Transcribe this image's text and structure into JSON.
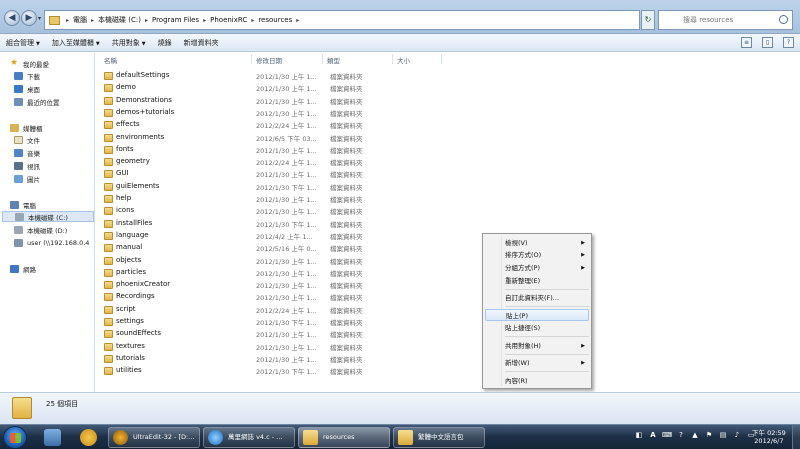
{
  "address": {
    "crumbs": [
      "電腦",
      "本機磁碟 (C:)",
      "Program Files",
      "PhoenixRC",
      "resources"
    ],
    "search_placeholder": "搜尋 resources"
  },
  "toolbar": {
    "organize": "組合管理",
    "include_library": "加入至媒體櫃",
    "share": "共用對象",
    "burn": "燒錄",
    "new_folder": "新增資料夾"
  },
  "nav": {
    "favorites": "我的最愛",
    "downloads": "下載",
    "desktop": "桌面",
    "recent": "最近的位置",
    "libraries": "媒體櫃",
    "documents": "文件",
    "music": "音樂",
    "videos": "視訊",
    "pictures": "圖片",
    "computer": "電腦",
    "drive_c": "本機磁碟 (C:)",
    "drive_d": "本機磁碟 (D:)",
    "network_drive": "user (\\\\192.168.0.4",
    "network": "網路"
  },
  "columns": {
    "name": "名稱",
    "date": "修改日期",
    "type": "類型",
    "size": "大小"
  },
  "files": [
    {
      "name": "defaultSettings",
      "date": "2012/1/30 上午 1...",
      "type": "檔案資料夾"
    },
    {
      "name": "demo",
      "date": "2012/1/30 上午 1...",
      "type": "檔案資料夾"
    },
    {
      "name": "Demonstrations",
      "date": "2012/1/30 上午 1...",
      "type": "檔案資料夾"
    },
    {
      "name": "demos+tutorials",
      "date": "2012/1/30 上午 1...",
      "type": "檔案資料夾"
    },
    {
      "name": "effects",
      "date": "2012/2/24 上午 1...",
      "type": "檔案資料夾"
    },
    {
      "name": "environments",
      "date": "2012/6/5 下午 03...",
      "type": "檔案資料夾"
    },
    {
      "name": "fonts",
      "date": "2012/1/30 上午 1...",
      "type": "檔案資料夾"
    },
    {
      "name": "geometry",
      "date": "2012/2/24 上午 1...",
      "type": "檔案資料夾"
    },
    {
      "name": "GUI",
      "date": "2012/1/30 上午 1...",
      "type": "檔案資料夾"
    },
    {
      "name": "guiElements",
      "date": "2012/1/30 下午 1...",
      "type": "檔案資料夾"
    },
    {
      "name": "help",
      "date": "2012/1/30 上午 1...",
      "type": "檔案資料夾"
    },
    {
      "name": "icons",
      "date": "2012/1/30 上午 1...",
      "type": "檔案資料夾"
    },
    {
      "name": "installFiles",
      "date": "2012/1/30 下午 1...",
      "type": "檔案資料夾"
    },
    {
      "name": "language",
      "date": "2012/4/2 上午 1...",
      "type": "檔案資料夾"
    },
    {
      "name": "manual",
      "date": "2012/5/16 上午 0...",
      "type": "檔案資料夾"
    },
    {
      "name": "objects",
      "date": "2012/1/30 上午 1...",
      "type": "檔案資料夾"
    },
    {
      "name": "particles",
      "date": "2012/1/30 上午 1...",
      "type": "檔案資料夾"
    },
    {
      "name": "phoenixCreator",
      "date": "2012/1/30 上午 1...",
      "type": "檔案資料夾"
    },
    {
      "name": "Recordings",
      "date": "2012/1/30 上午 1...",
      "type": "檔案資料夾"
    },
    {
      "name": "script",
      "date": "2012/2/24 上午 1...",
      "type": "檔案資料夾"
    },
    {
      "name": "settings",
      "date": "2012/1/30 下午 1...",
      "type": "檔案資料夾"
    },
    {
      "name": "soundEffects",
      "date": "2012/1/30 上午 1...",
      "type": "檔案資料夾"
    },
    {
      "name": "textures",
      "date": "2012/1/30 上午 1...",
      "type": "檔案資料夾"
    },
    {
      "name": "tutorials",
      "date": "2012/1/30 上午 1...",
      "type": "檔案資料夾"
    },
    {
      "name": "utilities",
      "date": "2012/1/30 下午 1...",
      "type": "檔案資料夾"
    }
  ],
  "context_menu": {
    "view": "檢視(V)",
    "sort": "排序方式(O)",
    "group": "分組方式(P)",
    "refresh": "重新整理(E)",
    "customize": "自訂此資料夾(F)...",
    "paste": "貼上(P)",
    "paste_shortcut": "貼上捷徑(S)",
    "share_with": "共用對象(H)",
    "new": "新增(W)",
    "properties": "內容(R)"
  },
  "details": {
    "item_count": "25 個項目"
  },
  "taskbar": {
    "ultraedit": "UltraEdit-32 - [D:...",
    "ie": "萬里網誌 v4.c - ...",
    "explorer": "resources",
    "translator": "繁體中文語言包"
  },
  "clock": {
    "time": "下午 02:59",
    "date": "2012/6/7"
  },
  "tray_ime": "A"
}
